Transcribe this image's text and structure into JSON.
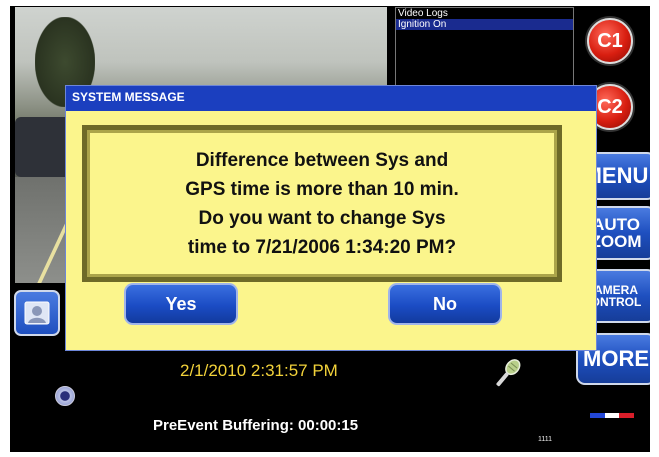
{
  "log_panel": {
    "items": [
      {
        "label": "Video Logs",
        "selected": false
      },
      {
        "label": "Ignition On",
        "selected": true
      }
    ]
  },
  "side_buttons": {
    "c1_label": "C1",
    "c2_label": "C2",
    "menu_label": "MENU",
    "auto_zoom_line1": "AUTO",
    "auto_zoom_line2": "ZOOM",
    "camera_control_line1": "AMERA",
    "camera_control_line2": "ONTROL",
    "more_label": "MORE"
  },
  "dialog": {
    "title": "SYSTEM MESSAGE",
    "message_lines": [
      "Difference between Sys and",
      "GPS time is more than 10 min.",
      "Do you want to change Sys",
      "time to 7/21/2006 1:34:20 PM?"
    ],
    "yes_label": "Yes",
    "no_label": "No"
  },
  "status": {
    "datetime": "2/1/2010 2:31:57 PM",
    "prevent_buffering": "PreEvent Buffering: 00:00:15",
    "small_number": "1111"
  },
  "icons": {
    "contact": "contact-card-icon",
    "mic": "microphone-icon",
    "record": "record-circle-icon"
  },
  "colors": {
    "dialog_blue": "#1b3fbf",
    "dialog_yellow": "#fbf58c",
    "accent_red": "#d81e10",
    "datetime_yellow": "#f2d23a"
  }
}
